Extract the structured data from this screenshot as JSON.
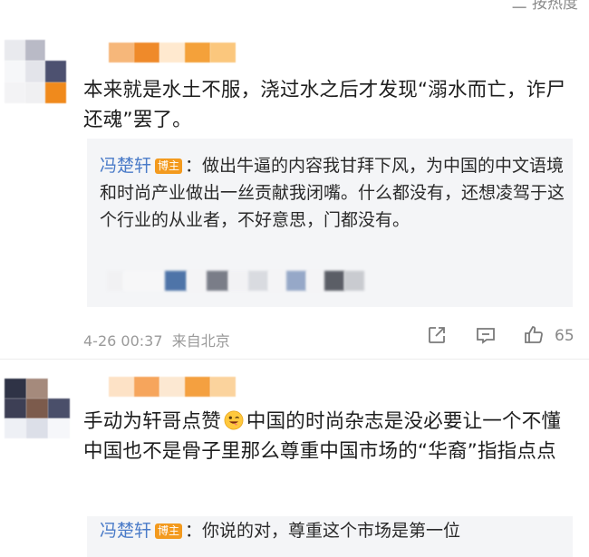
{
  "top_bar": {
    "sort_label": "二 按热度"
  },
  "comments": [
    {
      "text": "本来就是水土不服，浇过水之后才发现“溺水而亡，诈尸还魂”罢了。",
      "reply": {
        "author": "冯楚轩",
        "badge": "博主",
        "text": "：做出牛逼的内容我甘拜下风，为中国的中文语境和时尚产业做出一丝贡献我闭嘴。什么都没有，还想凌驾于这个行业的从业者，不好意思，门都没有。"
      },
      "timestamp": "4-26 00:37",
      "location": "来自北京",
      "like_count": "65"
    },
    {
      "text_before_emoji": "手动为轩哥点赞",
      "emoji": "grin-tongue-emoji",
      "text_after_emoji": "中国的时尚杂志是没必要让一个不懂中国也不是骨子里那么尊重中国市场的“华裔”指指点点",
      "reply": {
        "author": "冯楚轩",
        "badge": "博主",
        "text": "：你说的对，尊重这个市场是第一位"
      }
    }
  ],
  "colors": {
    "author_link": "#4a7bc8",
    "badge": "#f39a1e",
    "reply_bg": "#f4f5f7",
    "meta_gray": "#9a9a9a"
  },
  "icons": [
    "share-icon",
    "comment-icon",
    "like-icon"
  ]
}
